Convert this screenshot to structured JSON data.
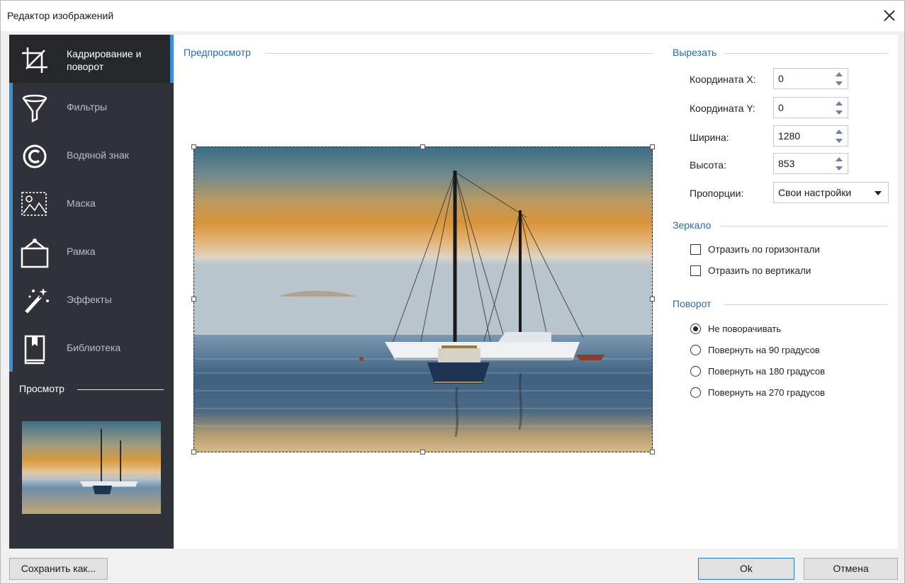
{
  "window": {
    "title": "Редактор изображений",
    "close_icon": "close-icon"
  },
  "sidebar": {
    "items": [
      {
        "label": "Кадрирование и поворот",
        "icon": "crop-icon",
        "active": true
      },
      {
        "label": "Фильтры",
        "icon": "funnel-icon"
      },
      {
        "label": "Водяной знак",
        "icon": "copyright-icon"
      },
      {
        "label": "Маска",
        "icon": "mask-icon"
      },
      {
        "label": "Рамка",
        "icon": "frame-icon"
      },
      {
        "label": "Эффекты",
        "icon": "magic-wand-icon"
      },
      {
        "label": "Библиотека",
        "icon": "book-icon"
      }
    ],
    "preview_label": "Просмотр"
  },
  "preview": {
    "title": "Предпросмотр"
  },
  "crop": {
    "title": "Вырезать",
    "x_label": "Координата X:",
    "x_value": "0",
    "y_label": "Координата Y:",
    "y_value": "0",
    "width_label": "Ширина:",
    "width_value": "1280",
    "height_label": "Высота:",
    "height_value": "853",
    "ratio_label": "Пропорции:",
    "ratio_value": "Свои настройки"
  },
  "mirror": {
    "title": "Зеркало",
    "horizontal": "Отразить по горизонтали",
    "vertical": "Отразить по вертикали"
  },
  "rotation": {
    "title": "Поворот",
    "options": [
      "Не поворачивать",
      "Повернуть на 90 градусов",
      "Повернуть на 180 градусов",
      "Повернуть на 270 градусов"
    ],
    "selected": 0
  },
  "footer": {
    "save_as": "Сохранить как...",
    "ok": "Ok",
    "cancel": "Отмена"
  },
  "colors": {
    "accent": "#3b8fd8",
    "sidebar": "#2f3238",
    "group_title": "#2b6aa8"
  }
}
